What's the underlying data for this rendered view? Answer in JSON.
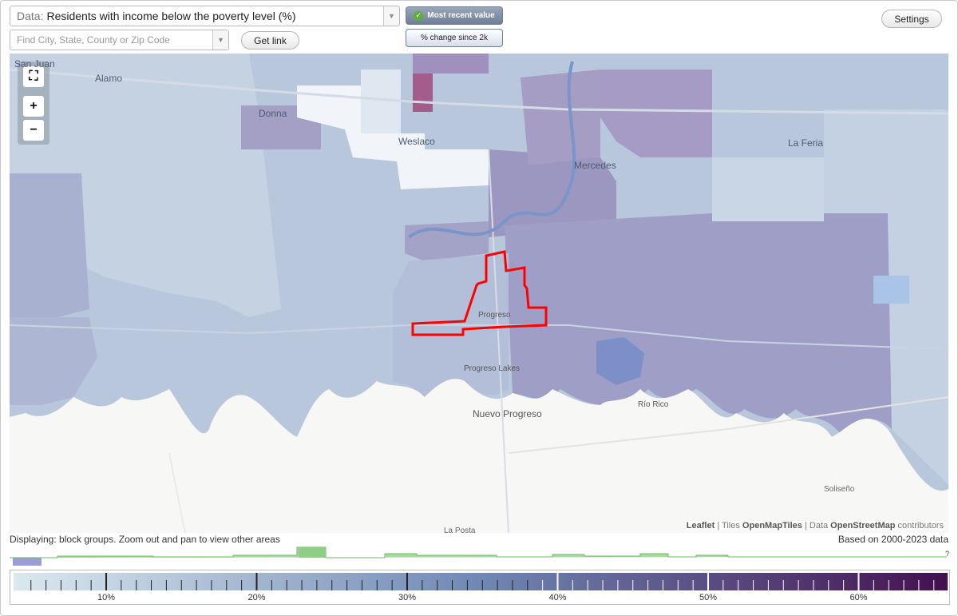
{
  "controls": {
    "data_prefix": "Data:",
    "data_value": "Residents with income below the poverty level (%)",
    "search_placeholder": "Find City, State, County or Zip Code",
    "get_link_label": "Get link",
    "toggle_recent_label": "Most recent value",
    "toggle_change_label": "% change since 2k",
    "settings_label": "Settings"
  },
  "map": {
    "zoom_in": "+",
    "zoom_out": "−",
    "place_labels": [
      {
        "id": "san-juan",
        "text": "San Juan"
      },
      {
        "id": "alamo",
        "text": "Alamo"
      },
      {
        "id": "donna",
        "text": "Donna"
      },
      {
        "id": "weslaco",
        "text": "Weslaco"
      },
      {
        "id": "mercedes",
        "text": "Mercedes"
      },
      {
        "id": "la-feria",
        "text": "La Feria"
      },
      {
        "id": "progreso",
        "text": "Progreso"
      },
      {
        "id": "progreso-lakes",
        "text": "Progreso Lakes"
      },
      {
        "id": "nuevo-progreso",
        "text": "Nuevo Progreso"
      },
      {
        "id": "rio-rico",
        "text": "Río Rico"
      },
      {
        "id": "soliseno",
        "text": "Soliseño"
      },
      {
        "id": "la-posta",
        "text": "La Posta"
      }
    ],
    "attribution": {
      "leaflet": "Leaflet",
      "sep1": " | Tiles ",
      "tiles": "OpenMapTiles",
      "sep2": " | Data ",
      "data": "OpenStreetMap",
      "contributors": " contributors"
    },
    "highlight_color": "#ff0000"
  },
  "status": {
    "displaying": "Displaying: block groups. Zoom out and pan to view other areas",
    "based_on": "Based on 2000-2023 data"
  },
  "legend": {
    "tick_labels": [
      "10%",
      "20%",
      "30%",
      "40%",
      "50%",
      "60%"
    ],
    "color_low": "#dbe8ef",
    "color_mid": "#6f88b4",
    "color_high": "#44104f",
    "histogram_color": "#8fce86",
    "unknown_label": "?"
  }
}
